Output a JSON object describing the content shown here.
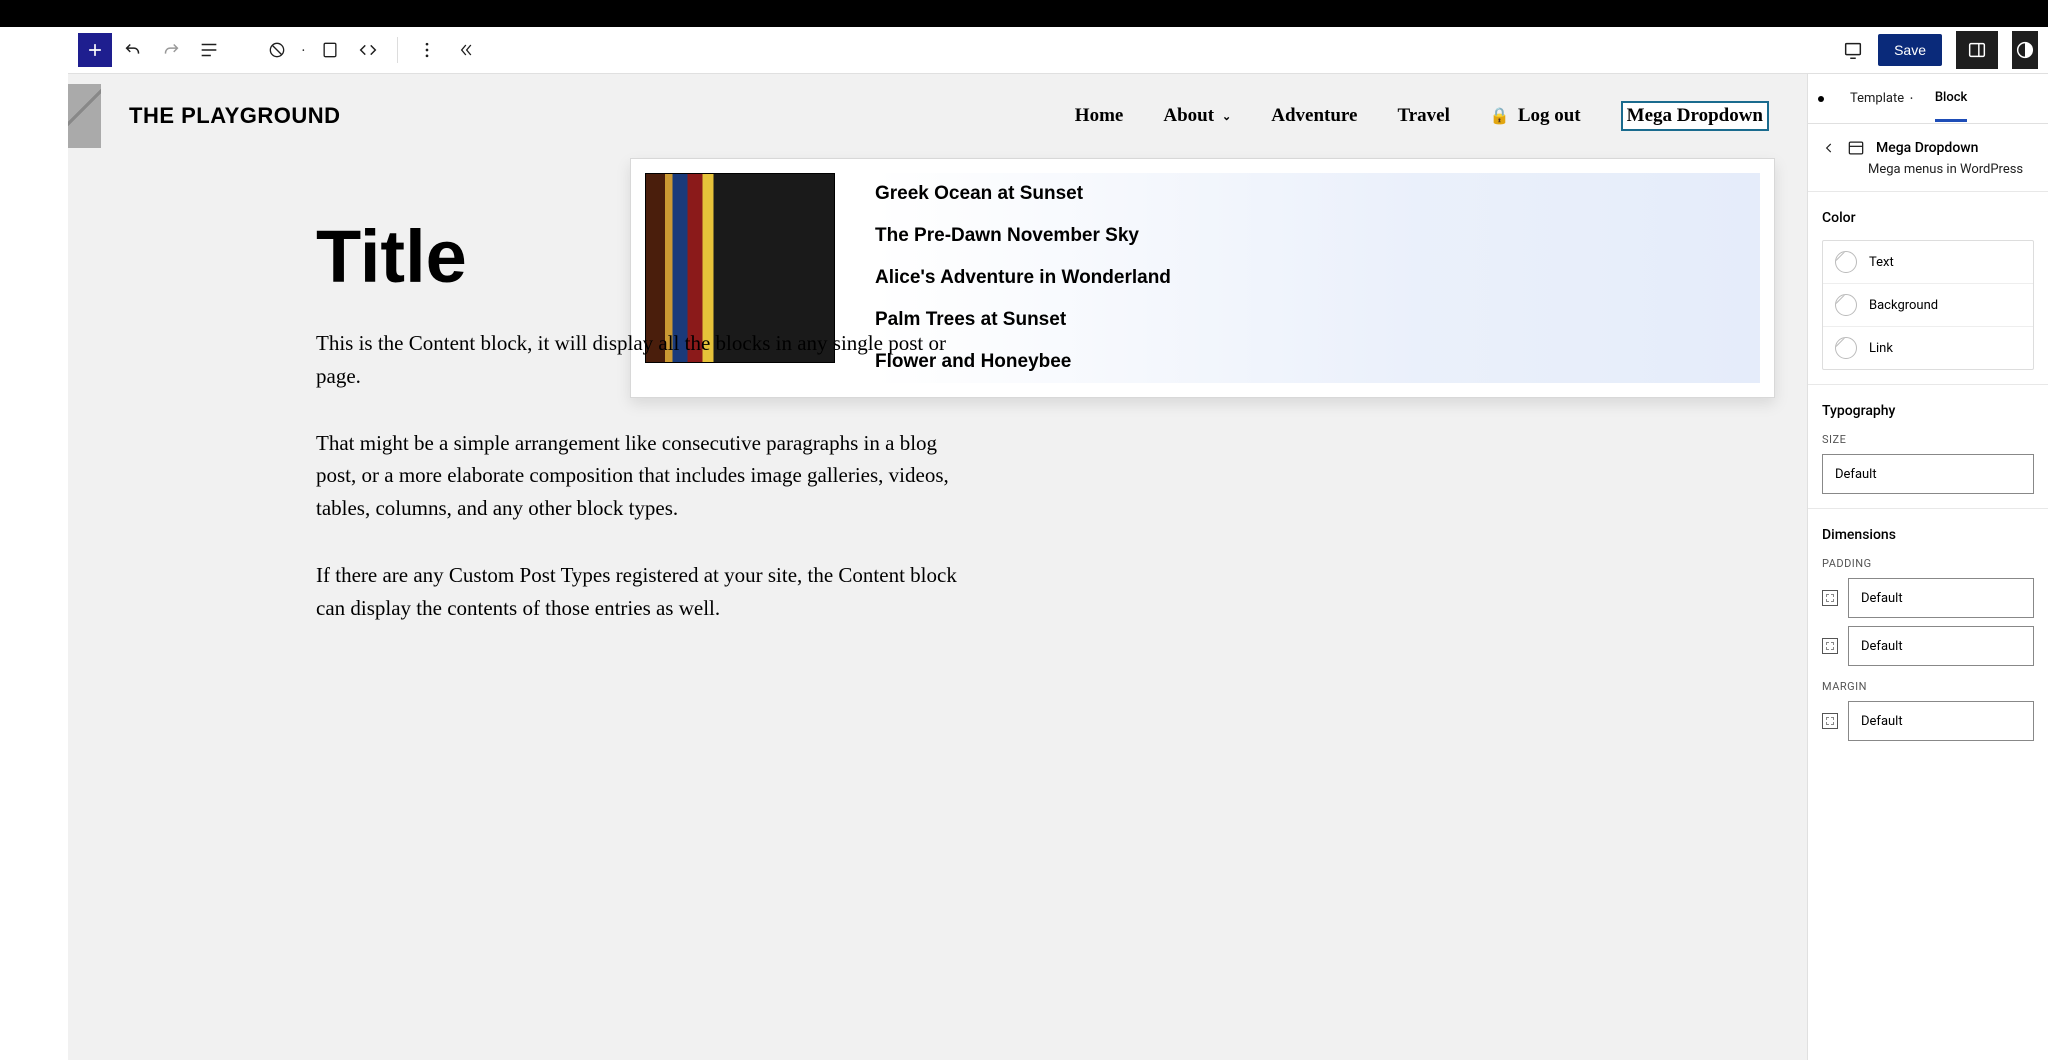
{
  "toolbar": {
    "save_label": "Save"
  },
  "site": {
    "title": "THE PLAYGROUND",
    "nav": {
      "home": "Home",
      "about": "About",
      "adventure": "Adventure",
      "travel": "Travel",
      "logout": "Log out",
      "mega_dropdown": "Mega Dropdown"
    }
  },
  "mega": {
    "items": [
      "Greek Ocean at Sunset",
      "The Pre-Dawn November Sky",
      "Alice's Adventure in Wonderland",
      "Palm Trees at Sunset",
      "Flower and Honeybee"
    ]
  },
  "page": {
    "title": "Title",
    "p1": "This is the Content block, it will display all the blocks in any single post or page.",
    "p2": "That might be a simple arrangement like consecutive paragraphs in a blog post, or a more elaborate composition that includes image galleries, videos, tables, columns, and any other block types.",
    "p3": "If there are any Custom Post Types registered at your site, the Content block can display the contents of those entries as well."
  },
  "sidebar": {
    "tabs": {
      "template": "Template",
      "block": "Block"
    },
    "block": {
      "title": "Mega Dropdown",
      "description": "Mega menus in WordPress"
    },
    "sections": {
      "color": {
        "title": "Color",
        "text": "Text",
        "background": "Background",
        "link": "Link"
      },
      "typography": {
        "title": "Typography",
        "size_label": "SIZE",
        "size_value": "Default"
      },
      "dimensions": {
        "title": "Dimensions",
        "padding_label": "PADDING",
        "margin_label": "MARGIN",
        "default": "Default"
      }
    }
  }
}
